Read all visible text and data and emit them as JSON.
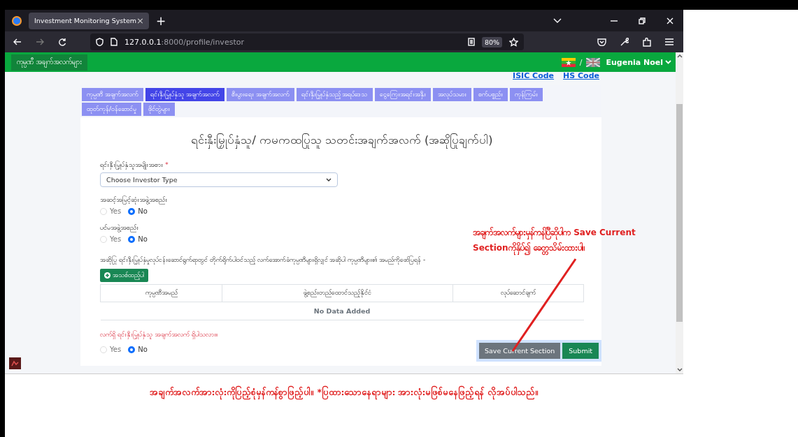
{
  "browser": {
    "tab_title": "Investment Monitoring System",
    "tab_close": "×",
    "new_tab": "+",
    "address_host": "127.0.0.1",
    "address_path": ":8000/profile/investor",
    "zoom": "80%"
  },
  "header": {
    "menu_button": "ကုမ္ပဏီ အချက်အလက်များ",
    "language_separator": "/",
    "user_name": "Eugenia Noel"
  },
  "code_links": [
    "ISIC Code",
    "HS Code"
  ],
  "tabs": [
    {
      "label": "ကုမ္ပဏီ အချက်အလက်",
      "selected": false
    },
    {
      "label": "ရင်းနှီးမြှုပ်နှံသူ အချက်အလက်",
      "selected": true
    },
    {
      "label": "စီးပွားရေး အချက်အလက်",
      "selected": false
    },
    {
      "label": "ရင်းနှီးမြှုပ်နှံသည့် အရပ်ဒေသ",
      "selected": false
    },
    {
      "label": "ငွေကြေးအရင်းအနှီး",
      "selected": false
    },
    {
      "label": "အလုပ်သမား",
      "selected": false
    },
    {
      "label": "စက်ပစ္စည်း",
      "selected": false
    },
    {
      "label": "ကုန်ကြမ်း",
      "selected": false
    },
    {
      "label": "ထုတ်ကုန်/ဝန်ဆောင်မှု",
      "selected": false
    },
    {
      "label": "ဖိုင်တွဲများ",
      "selected": false
    }
  ],
  "form": {
    "title": "ရင်းနှီးမြှုပ်နှံသူ/ ကမကထပြုသူ သတင်းအချက်အလက် (အဆိုပြုချက်ပါ)",
    "investor_type": {
      "label": "ရင်းနှီးမြှုပ်နှံသူအမျိုးအစား",
      "required_mark": "*",
      "value": "Choose Investor Type"
    },
    "questions": [
      {
        "label": "အဆင့်အမြင့်ဆုံးအဖွဲ့အစည်း",
        "options": [
          {
            "label": "Yes",
            "selected": false
          },
          {
            "label": "No",
            "selected": true
          }
        ]
      },
      {
        "label": "ပင်မအဖွဲ့အစည်း",
        "options": [
          {
            "label": "Yes",
            "selected": false
          },
          {
            "label": "No",
            "selected": true
          }
        ]
      }
    ],
    "subsidiaries": {
      "description": "အဆိုပြု ရင်းနှီးမြှုပ်နှံမှုလုပ်ငန်းဆောင်ရွက်ရာတွင် တိုက်ရိုက်ပါဝင်သည့် လက်အောက်ခံကုမ္ပဏီများရှိလျှင် အဆိုပါ ကုမ္ပဏီများ၏ အမည်ကိုဖော်ပြရန် -",
      "add_button": "အသစ်ထည့်ပါ",
      "columns": [
        "ကုမ္ပဏီအမည်",
        "ဖွဲ့စည်းတည်ထောင်သည့်နိုင်ငံ",
        "လုပ်ဆောင်ချက်"
      ],
      "empty_text": "No Data Added"
    },
    "current_investor": {
      "label": "လက်ရှိ ရင်းနှီးမြှုပ်နှံသူ အချက်အလက် ရှိပါသလား။",
      "options": [
        {
          "label": "Yes",
          "selected": false
        },
        {
          "label": "No",
          "selected": true
        }
      ]
    },
    "buttons": [
      "Save Current Section",
      "Submit"
    ]
  },
  "annotation": {
    "note": "အချက်အလက်များမှန်ကန်ပြီဆိုပါက Save Current Sectionကိုနှိပ်၍ ခေတ္တသိမ်းထားပါ။",
    "caption": "အချက်အလက်အားလုံးကိုပြည့်စုံမှန်ကန်စွာဖြည့်ပါ။ *ပြထားသောနေရာများ အားလုံးမဖြစ်မနေဖြည့်ရန် လိုအပ်ပါသည်။"
  }
}
